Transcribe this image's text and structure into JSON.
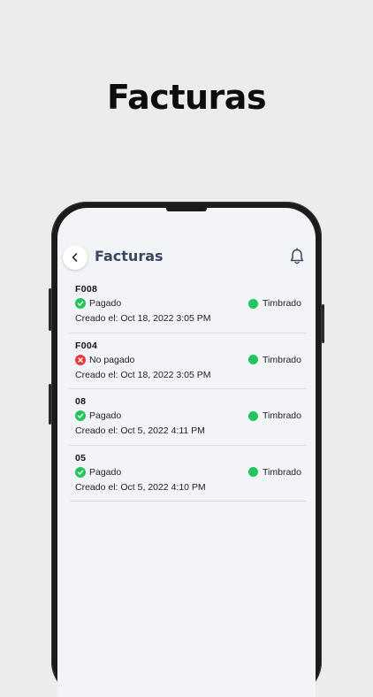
{
  "hero": {
    "title": "Facturas"
  },
  "header": {
    "title": "Facturas"
  },
  "icons": {
    "back": "chevron-left-icon",
    "notifications": "bell-icon",
    "paid": "check-circle-icon",
    "unpaid": "x-circle-icon",
    "stamped": "green-dot"
  },
  "colors": {
    "paid": "#22c55e",
    "unpaid": "#e23b3b",
    "stamped": "#22c55e",
    "header_text": "#3b4660",
    "screen_bg": "#f2f4f8"
  },
  "invoices": [
    {
      "id": "F008",
      "payment_status": "Pagado",
      "paid": true,
      "stamp_status": "Timbrado",
      "created": "Creado el: Oct 18, 2022 3:05 PM"
    },
    {
      "id": "F004",
      "payment_status": "No pagado",
      "paid": false,
      "stamp_status": "Timbrado",
      "created": "Creado el: Oct 18, 2022 3:05 PM"
    },
    {
      "id": "08",
      "payment_status": "Pagado",
      "paid": true,
      "stamp_status": "Timbrado",
      "created": "Creado el: Oct 5, 2022 4:11 PM"
    },
    {
      "id": "05",
      "payment_status": "Pagado",
      "paid": true,
      "stamp_status": "Timbrado",
      "created": "Creado el: Oct 5, 2022 4:10 PM"
    }
  ]
}
